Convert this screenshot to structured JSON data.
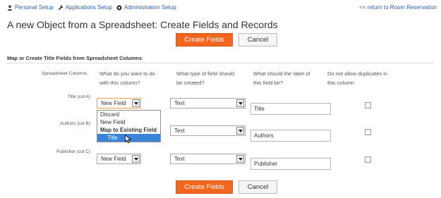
{
  "nav": {
    "items": [
      {
        "label": "Personal Setup",
        "icon": "user-icon"
      },
      {
        "label": "Applications Setup",
        "icon": "wrench-icon"
      },
      {
        "label": "Administration Setup",
        "icon": "gear-icon"
      }
    ],
    "return_link": "<< return to Room Reservation"
  },
  "page": {
    "title": "A new Object from a Spreadsheet: Create Fields and Records"
  },
  "buttons": {
    "create": "Create Fields",
    "cancel": "Cancel"
  },
  "section": {
    "title": "Map or Create Title Fields from Spreadsheet Columns"
  },
  "columns": {
    "spreadsheet": "Spreadsheet Columns",
    "action_line1": "What do you want to do",
    "action_line2": "with this column?",
    "type_line1": "What type of field should",
    "type_line2": "be created?",
    "label_line1": "What should the label of",
    "label_line2": "this field be?",
    "dup_line1": "Do not allow duplicates in",
    "dup_line2": "this column"
  },
  "rows": [
    {
      "column": "Title (col A)",
      "action": "New Field",
      "type": "Text",
      "label": "Title",
      "no_duplicates": false
    },
    {
      "column": "Authors (col B)",
      "action": "New Field",
      "type": "Text",
      "label": "Authors",
      "no_duplicates": false
    },
    {
      "column": "Publisher (col C)",
      "action": "New Field",
      "type": "Text",
      "label": "Publisher",
      "no_duplicates": false
    }
  ],
  "dropdown": {
    "options": [
      "Discard",
      "New Field",
      "Map to Existing Field",
      "Title"
    ],
    "selected": "Title"
  },
  "colors": {
    "accent": "#f2661f",
    "link": "#2a5db0",
    "selection": "#3a84d8"
  }
}
